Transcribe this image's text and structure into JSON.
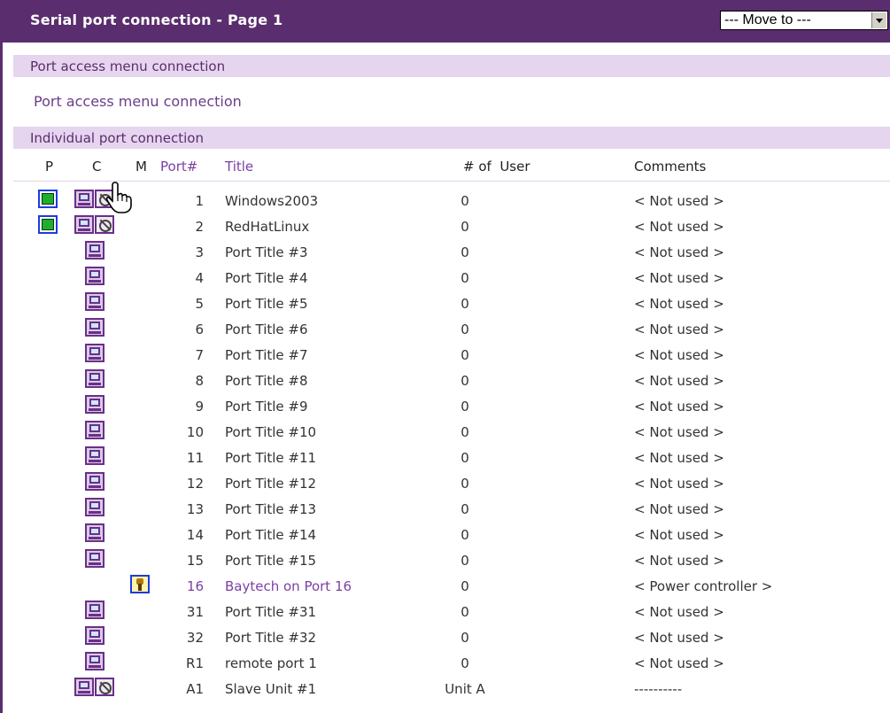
{
  "header": {
    "title": "Serial port connection - Page 1",
    "move_to": "--- Move to ---"
  },
  "sections": {
    "menu": "Port access menu connection",
    "individual": "Individual port connection"
  },
  "menu_link": "Port access menu connection",
  "columns": {
    "p": "P",
    "c": "C",
    "m": "M",
    "port": "Port#",
    "title": "Title",
    "users": "# of  User",
    "comments": "Comments"
  },
  "rows": [
    {
      "port": "1",
      "title": "Windows2003",
      "users": "0",
      "comment": "< Not used >",
      "icons": [
        "power",
        "connect",
        "busy"
      ]
    },
    {
      "port": "2",
      "title": "RedHatLinux",
      "users": "0",
      "comment": "< Not used >",
      "icons": [
        "power",
        "connect",
        "busy"
      ]
    },
    {
      "port": "3",
      "title": "Port Title #3",
      "users": "0",
      "comment": "< Not used >",
      "icons": [
        "connect"
      ]
    },
    {
      "port": "4",
      "title": "Port Title #4",
      "users": "0",
      "comment": "< Not used >",
      "icons": [
        "connect"
      ]
    },
    {
      "port": "5",
      "title": "Port Title #5",
      "users": "0",
      "comment": "< Not used >",
      "icons": [
        "connect"
      ]
    },
    {
      "port": "6",
      "title": "Port Title #6",
      "users": "0",
      "comment": "< Not used >",
      "icons": [
        "connect"
      ]
    },
    {
      "port": "7",
      "title": "Port Title #7",
      "users": "0",
      "comment": "< Not used >",
      "icons": [
        "connect"
      ]
    },
    {
      "port": "8",
      "title": "Port Title #8",
      "users": "0",
      "comment": "< Not used >",
      "icons": [
        "connect"
      ]
    },
    {
      "port": "9",
      "title": "Port Title #9",
      "users": "0",
      "comment": "< Not used >",
      "icons": [
        "connect"
      ]
    },
    {
      "port": "10",
      "title": "Port Title #10",
      "users": "0",
      "comment": "< Not used >",
      "icons": [
        "connect"
      ]
    },
    {
      "port": "11",
      "title": "Port Title #11",
      "users": "0",
      "comment": "< Not used >",
      "icons": [
        "connect"
      ]
    },
    {
      "port": "12",
      "title": "Port Title #12",
      "users": "0",
      "comment": "< Not used >",
      "icons": [
        "connect"
      ]
    },
    {
      "port": "13",
      "title": "Port Title #13",
      "users": "0",
      "comment": "< Not used >",
      "icons": [
        "connect"
      ]
    },
    {
      "port": "14",
      "title": "Port Title #14",
      "users": "0",
      "comment": "< Not used >",
      "icons": [
        "connect"
      ]
    },
    {
      "port": "15",
      "title": "Port Title #15",
      "users": "0",
      "comment": "< Not used >",
      "icons": [
        "connect"
      ]
    },
    {
      "port": "16",
      "title": "Baytech on Port 16",
      "users": "0",
      "comment": "< Power controller >",
      "icons": [
        "manage"
      ],
      "power": true
    },
    {
      "port": "31",
      "title": "Port Title #31",
      "users": "0",
      "comment": "< Not used >",
      "icons": [
        "connect"
      ]
    },
    {
      "port": "32",
      "title": "Port Title #32",
      "users": "0",
      "comment": "< Not used >",
      "icons": [
        "connect"
      ]
    },
    {
      "port": "R1",
      "title": "remote port 1",
      "users": "0",
      "comment": "< Not used >",
      "icons": [
        "connect"
      ]
    },
    {
      "port": "A1",
      "title": "Slave Unit #1",
      "users": "Unit A",
      "comment": "----------",
      "icons": [
        "connect",
        "busy"
      ]
    }
  ],
  "colors": {
    "accent": "#5a2d6e",
    "section_bg": "#e6d5ef",
    "link": "#7b3fa3",
    "power_green": "#1fae2e",
    "icon_blue": "#1e3be0"
  }
}
